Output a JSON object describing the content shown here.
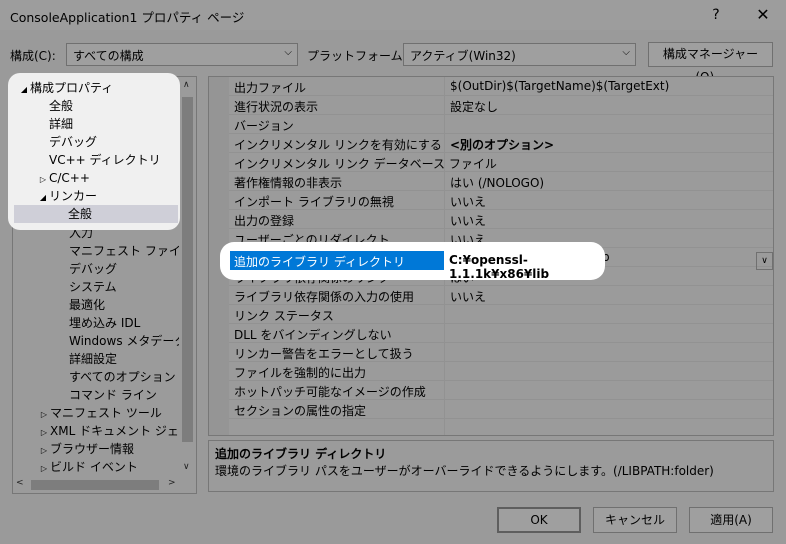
{
  "window": {
    "title": "ConsoleApplication1 プロパティ ページ",
    "help": "?",
    "close": "✕"
  },
  "config": {
    "config_label": "構成(C):",
    "config_value": "すべての構成",
    "platform_label": "プラットフォーム(P):",
    "platform_value": "アクティブ(Win32)",
    "manager_button": "構成マネージャー(O)..."
  },
  "tree": {
    "items": [
      {
        "label": "構成プロパティ",
        "twisty": "◢",
        "indent": 0
      },
      {
        "label": "全般",
        "twisty": "",
        "indent": 1
      },
      {
        "label": "詳細",
        "twisty": "",
        "indent": 1
      },
      {
        "label": "デバッグ",
        "twisty": "",
        "indent": 1
      },
      {
        "label": "VC++ ディレクトリ",
        "twisty": "",
        "indent": 1
      },
      {
        "label": "C/C++",
        "twisty": "▷",
        "indent": 1
      },
      {
        "label": "リンカー",
        "twisty": "◢",
        "indent": 1
      },
      {
        "label": "全般",
        "twisty": "",
        "indent": 2
      },
      {
        "label": "入力",
        "twisty": "",
        "indent": 2
      },
      {
        "label": "マニフェスト ファイル",
        "twisty": "",
        "indent": 2
      },
      {
        "label": "デバッグ",
        "twisty": "",
        "indent": 2
      },
      {
        "label": "システム",
        "twisty": "",
        "indent": 2
      },
      {
        "label": "最適化",
        "twisty": "",
        "indent": 2
      },
      {
        "label": "埋め込み IDL",
        "twisty": "",
        "indent": 2
      },
      {
        "label": "Windows メタデータ",
        "twisty": "",
        "indent": 2
      },
      {
        "label": "詳細設定",
        "twisty": "",
        "indent": 2
      },
      {
        "label": "すべてのオプション",
        "twisty": "",
        "indent": 2
      },
      {
        "label": "コマンド ライン",
        "twisty": "",
        "indent": 2
      },
      {
        "label": "マニフェスト ツール",
        "twisty": "▷",
        "indent": 1
      },
      {
        "label": "XML ドキュメント ジェネレー",
        "twisty": "▷",
        "indent": 1
      },
      {
        "label": "ブラウザー情報",
        "twisty": "▷",
        "indent": 1
      },
      {
        "label": "ビルド イベント",
        "twisty": "▷",
        "indent": 1
      }
    ]
  },
  "grid": {
    "rows": [
      {
        "name": "出力ファイル",
        "value": "$(OutDir)$(TargetName)$(TargetExt)"
      },
      {
        "name": "進行状況の表示",
        "value": "設定なし"
      },
      {
        "name": "バージョン",
        "value": ""
      },
      {
        "name": "インクリメンタル リンクを有効にする",
        "value": "<別のオプション>"
      },
      {
        "name": "インクリメンタル リンク データベース ファイル",
        "value": ""
      },
      {
        "name": "著作権情報の非表示",
        "value": "はい (/NOLOGO)"
      },
      {
        "name": "インポート ライブラリの無視",
        "value": "いいえ"
      },
      {
        "name": "出力の登録",
        "value": "いいえ"
      },
      {
        "name": "ユーザーごとのリダイレクト",
        "value": "いいえ"
      },
      {
        "name": "追加のライブラリ ディレクトリ",
        "value": "C:¥openssl-1.1.1k¥x86¥lib"
      },
      {
        "name": "ライブラリ依存関係のリンク",
        "value": "はい"
      },
      {
        "name": "ライブラリ依存関係の入力の使用",
        "value": "いいえ"
      },
      {
        "name": "リンク ステータス",
        "value": ""
      },
      {
        "name": "DLL をバインディングしない",
        "value": ""
      },
      {
        "name": "リンカー警告をエラーとして扱う",
        "value": ""
      },
      {
        "name": "ファイルを強制的に出力",
        "value": ""
      },
      {
        "name": "ホットパッチ可能なイメージの作成",
        "value": ""
      },
      {
        "name": "セクションの属性の指定",
        "value": ""
      }
    ]
  },
  "description": {
    "title": "追加のライブラリ ディレクトリ",
    "text": "環境のライブラリ パスをユーザーがオーバーライドできるようにします。(/LIBPATH:folder)"
  },
  "buttons": {
    "ok": "OK",
    "cancel": "キャンセル",
    "apply": "適用(A)"
  }
}
